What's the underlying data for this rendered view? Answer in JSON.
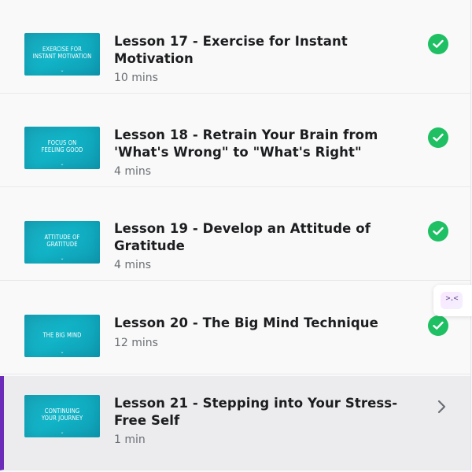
{
  "lessons": [
    {
      "thumb_text": "EXERCISE FOR\nINSTANT MOTIVATION",
      "title": "Lesson 17 - Exercise for Instant Motivation",
      "duration": "10 mins",
      "status": "completed",
      "icon": "check-circle-icon"
    },
    {
      "thumb_text": "FOCUS ON\nFEELING GOOD",
      "title": "Lesson 18 - Retrain Your Brain from 'What's Wrong\" to \"What's Right\"",
      "duration": "4 mins",
      "status": "completed",
      "icon": "check-circle-icon"
    },
    {
      "thumb_text": "ATTITUDE OF\nGRATITUDE",
      "title": "Lesson 19 - Develop an Attitude of Gratitude",
      "duration": "4 mins",
      "status": "completed",
      "icon": "check-circle-icon"
    },
    {
      "thumb_text": "THE BIG MIND",
      "title": "Lesson 20 - The Big Mind Technique",
      "duration": "12 mins",
      "status": "completed",
      "icon": "check-circle-icon"
    },
    {
      "thumb_text": "CONTINUING\nYOUR JOURNEY",
      "title": "Lesson 21 - Stepping into Your Stress-Free Self",
      "duration": "1 min",
      "status": "current",
      "icon": "chevron-right-icon"
    }
  ],
  "widget": {
    "face": ">.<",
    "icon": "chat-widget-icon"
  },
  "colors": {
    "accent": "#6c2bb8",
    "check": "#1fbf63",
    "thumb": "#12b5c8",
    "title": "#1c1d1f",
    "duration": "#6a6f73"
  }
}
